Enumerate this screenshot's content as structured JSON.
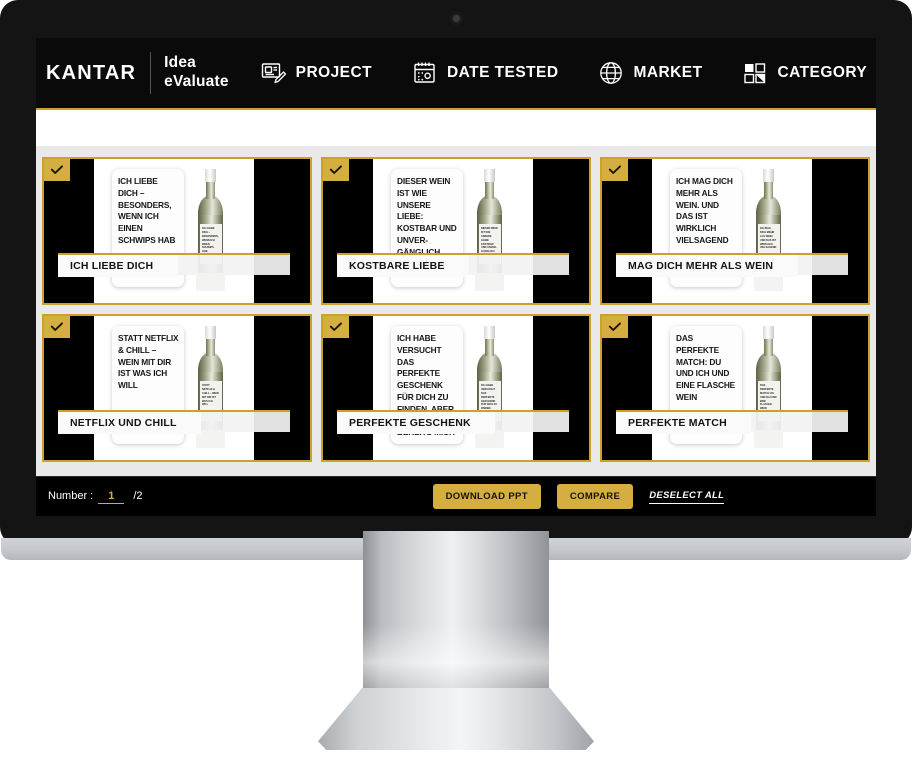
{
  "header": {
    "brand": "KANTAR",
    "product": "Idea\neValuate",
    "nav": [
      {
        "label": "PROJECT",
        "icon": "project-icon"
      },
      {
        "label": "DATE TESTED",
        "icon": "calendar-icon"
      },
      {
        "label": "MARKET",
        "icon": "globe-icon"
      },
      {
        "label": "CATEGORY",
        "icon": "category-grid-icon"
      }
    ]
  },
  "colors": {
    "gold": "#c9a227",
    "gold_button": "#d4ae40",
    "screen_bg": "#000000",
    "content_bg": "#e9e9e9"
  },
  "cards": [
    {
      "title": "ICH LIEBE DICH",
      "concept_text": "ICH LIEBE DICH – BESONDERS, WENN ICH EINEN SCHWIPS HAB",
      "selected": true
    },
    {
      "title": "KOSTBARE LIEBE",
      "concept_text": "DIESER WEIN IST WIE UNSERE LIEBE: KOSTBAR UND UNVER-GÄNGLICH",
      "selected": true
    },
    {
      "title": "MAG DICH MEHR ALS WEIN",
      "concept_text": "ICH MAG DICH MEHR ALS WEIN. UND DAS IST WIRKLICH VIELSAGEND",
      "selected": true
    },
    {
      "title": "NETFLIX UND CHILL",
      "concept_text": "STATT NETFLIX & CHILL – WEIN MIT DIR IST WAS ICH WILL",
      "selected": true
    },
    {
      "title": "PERFEKTE GESCHENK",
      "concept_text": "ICH HABE VERSUCHT DAS PERFEKTE GESCHENK FÜR DICH ZU FINDEN. ABER DU HAST JA BEREITS MICH",
      "selected": true
    },
    {
      "title": "PERFEKTE MATCH",
      "concept_text": "DAS PERFEKTE MATCH: DU UND ICH UND EINE FLASCHE WEIN",
      "selected": true
    }
  ],
  "bottom_bar": {
    "number_label": "Number :",
    "page_current": "1",
    "page_total": "/2",
    "download_ppt": "DOWNLOAD PPT",
    "compare": "COMPARE",
    "deselect_all": "DESELECT ALL"
  }
}
